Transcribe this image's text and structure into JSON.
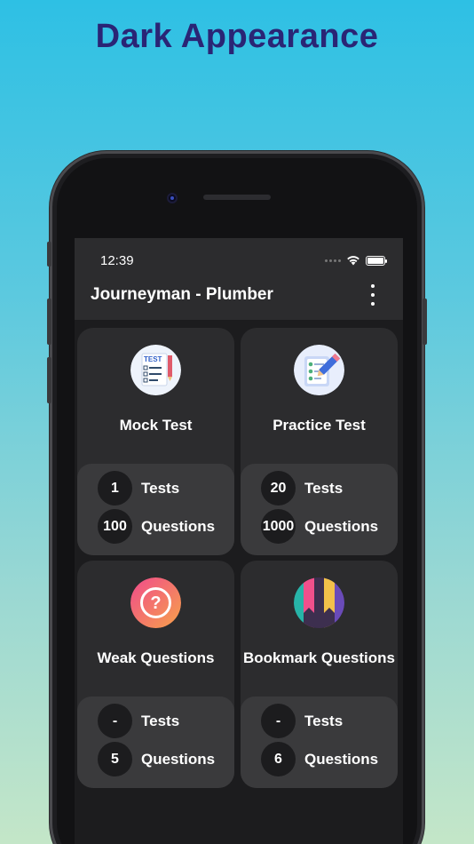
{
  "headline": "Dark Appearance",
  "status_bar": {
    "time": "12:39",
    "icons": [
      "signal-icon",
      "wifi-icon",
      "battery-icon"
    ]
  },
  "app_bar": {
    "title": "Journeyman - Plumber",
    "menu_icon": "more-vertical-icon"
  },
  "cards": [
    {
      "title": "Mock Test",
      "icon": "test-checklist-icon",
      "tests_value": "1",
      "tests_label": "Tests",
      "questions_value": "100",
      "questions_label": "Questions"
    },
    {
      "title": "Practice Test",
      "icon": "clipboard-pencil-icon",
      "tests_value": "20",
      "tests_label": "Tests",
      "questions_value": "1000",
      "questions_label": "Questions"
    },
    {
      "title": "Weak Questions",
      "icon": "question-mark-icon",
      "tests_value": "-",
      "tests_label": "Tests",
      "questions_value": "5",
      "questions_label": "Questions"
    },
    {
      "title": "Bookmark Questions",
      "icon": "bookmarks-icon",
      "tests_value": "-",
      "tests_label": "Tests",
      "questions_value": "6",
      "questions_label": "Questions"
    }
  ],
  "colors": {
    "headline": "#2a2575",
    "screen_bg": "#1c1c1e",
    "card_bg": "#2c2c2e",
    "stats_bg": "#3a3a3c"
  }
}
